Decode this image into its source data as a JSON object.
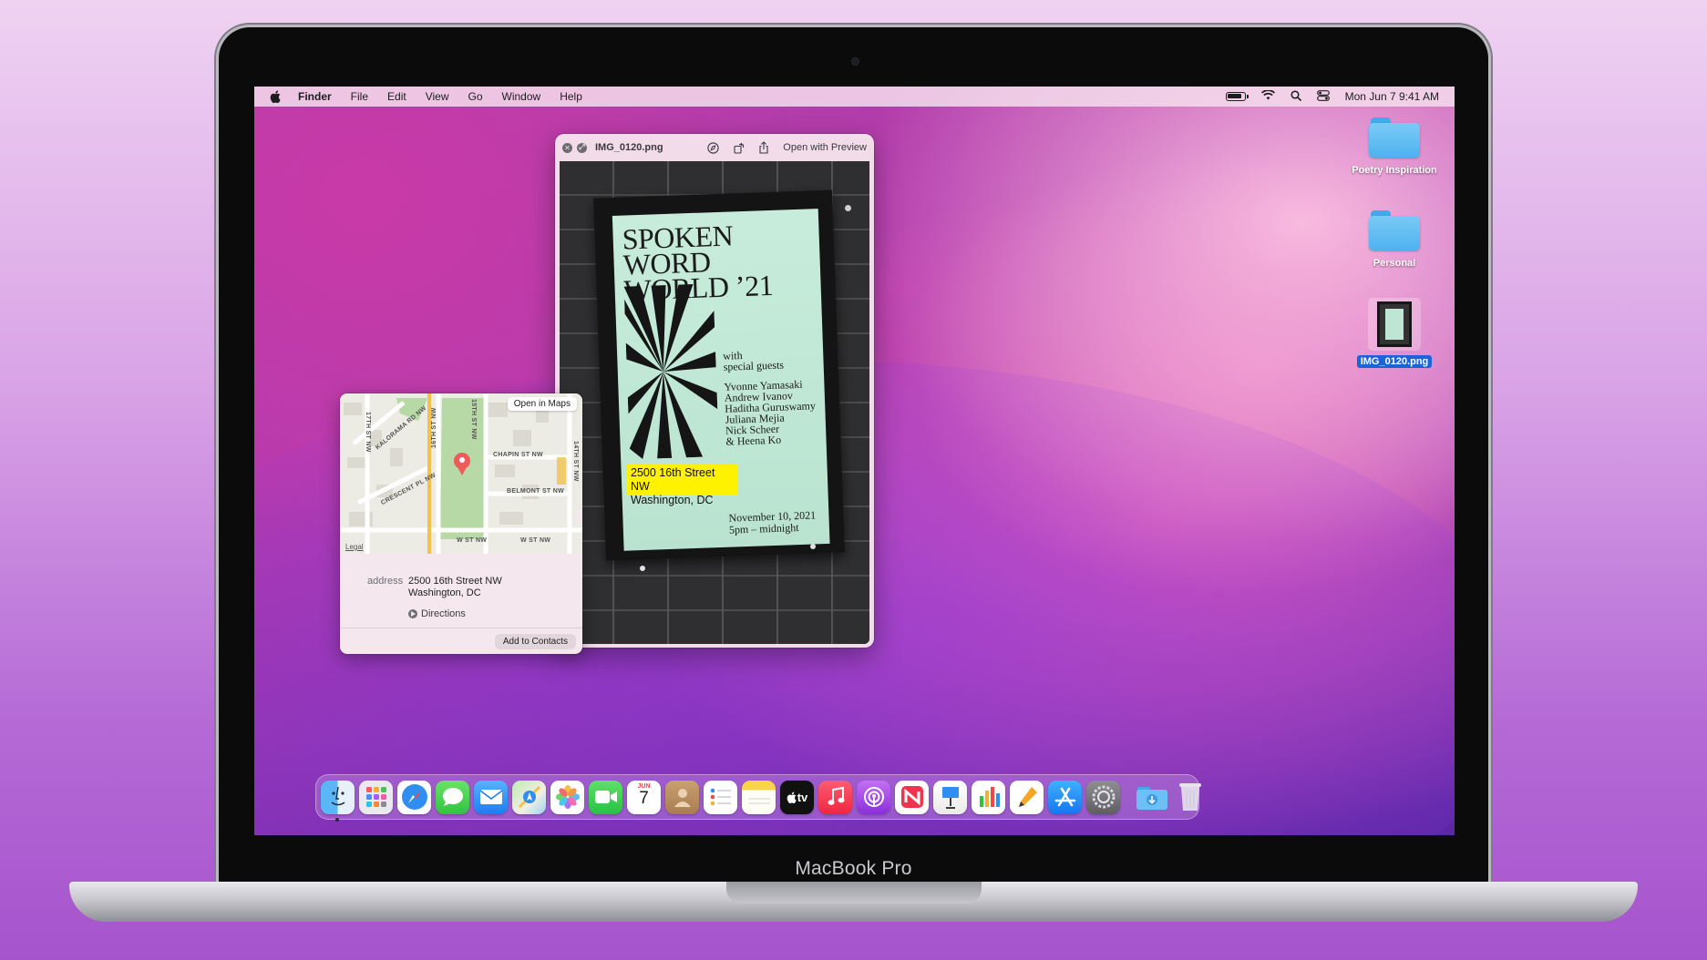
{
  "device": {
    "label": "MacBook Pro"
  },
  "menubar": {
    "app_name": "Finder",
    "items": [
      "File",
      "Edit",
      "View",
      "Go",
      "Window",
      "Help"
    ],
    "clock": "Mon Jun 7  9:41 AM"
  },
  "desktop": {
    "icons": [
      {
        "label": "Poetry Inspiration",
        "kind": "folder"
      },
      {
        "label": "Personal",
        "kind": "folder"
      },
      {
        "label": "IMG_0120.png",
        "kind": "image",
        "selected": true
      }
    ]
  },
  "quicklook": {
    "filename": "IMG_0120.png",
    "open_with_label": "Open with Preview",
    "poster": {
      "title_line1": "SPOKEN WORD",
      "title_line2": "WORLD ’21",
      "with_line1": "with",
      "with_line2": "special guests",
      "guests": [
        "Yvonne Yamasaki",
        "Andrew Ivanov",
        "Haditha Guruswamy",
        "Juliana Mejia",
        "Nick Scheer",
        "& Heena Ko"
      ],
      "date_line1": "November 10, 2021",
      "date_line2": "5pm – midnight"
    },
    "detected_text": {
      "line1": "2500 16th Street NW",
      "line2": "Washington, DC"
    }
  },
  "map_popover": {
    "open_in_maps_label": "Open in Maps",
    "legal_label": "Legal",
    "streets": [
      "16TH ST NW",
      "15TH ST NW",
      "14TH ST NW",
      "17TH ST NW",
      "KALORAMA RD NW",
      "CHAPIN ST NW",
      "CRESCENT PL NW",
      "BELMONT ST NW",
      "W ST NW",
      "W ST NW"
    ],
    "address_key": "address",
    "address_line1": "2500 16th Street NW",
    "address_line2": "Washington, DC",
    "directions_label": "Directions",
    "add_contacts_label": "Add to Contacts"
  },
  "dock": {
    "apps": [
      "Finder",
      "Launchpad",
      "Safari",
      "Messages",
      "Mail",
      "Maps",
      "Photos",
      "FaceTime",
      "Calendar",
      "Contacts",
      "Reminders",
      "Notes",
      "TV",
      "Music",
      "Podcasts",
      "News",
      "Keynote",
      "Numbers",
      "Pages",
      "App Store",
      "System Preferences",
      "Downloads",
      "Trash"
    ],
    "calendar_month": "JUN",
    "calendar_day": "7",
    "tv_label": "tv"
  },
  "colors": {
    "highlight": "#fff200",
    "selection": "#1b64d8",
    "folder": "#5ab8f0"
  }
}
